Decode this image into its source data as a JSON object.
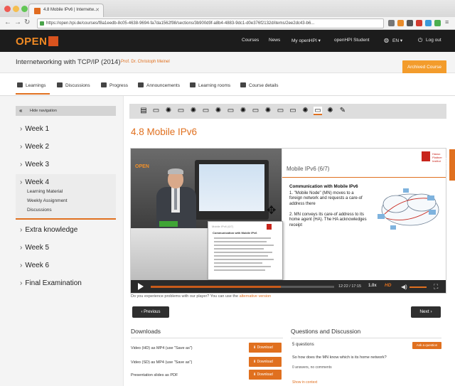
{
  "browser": {
    "tab_title": "4.8 Mobile IPv6 | Internetw...",
    "url": "https://open.hpi.de/courses/f8a1eedb-8c05-4638-9694-fa7da1562f98/sections/3b900d9f-a8b4-4883-9dc1-d0e376f2132d/items/2ee2dc43-b6...",
    "colors": {
      "close": "#ee5a52",
      "minimize": "#f5be4f",
      "zoom": "#62c655"
    }
  },
  "site": {
    "logo": "OPEN",
    "nav": [
      "Courses",
      "News",
      "My openHPI ▾",
      "openHPI Student",
      "EN ▾",
      "Log out"
    ],
    "accent": "#e0701f"
  },
  "course": {
    "title": "Internetworking with TCP/IP (2014)",
    "professor": "Prof. Dr. Christoph Meinel",
    "archived_label": "Archived Course"
  },
  "tabs": [
    "Learnings",
    "Discussions",
    "Progress",
    "Announcements",
    "Learning rooms",
    "Course details"
  ],
  "sidebar": {
    "hide_nav": "Hide navigation",
    "weeks": [
      "Week 1",
      "Week 2",
      "Week 3",
      "Week 4",
      "Extra knowledge",
      "Week 5",
      "Week 6",
      "Final Examination"
    ],
    "week4_items": [
      "Learning Material",
      "Weekly Assignment",
      "Discussions"
    ]
  },
  "item": {
    "title": "4.8 Mobile IPv6",
    "strip_icons": [
      "document-icon",
      "video-icon",
      "bulb-icon",
      "video-icon",
      "bulb-icon",
      "video-icon",
      "bulb-icon",
      "video-icon",
      "bulb-icon",
      "video-icon",
      "bulb-icon",
      "video-icon",
      "video-icon",
      "bulb-icon",
      "video-icon",
      "bulb-icon",
      "edit-icon"
    ],
    "selected_index": 14
  },
  "video": {
    "studio_logo": "OPEN",
    "slide_title": "Mobile IPv6 (6/7)",
    "slide_heading": "Communication with Mobile IPv6",
    "points": [
      "1.  \"Mobile Node\" (MN) moves to a foreign network and requests a care-of address there",
      "2.  MN conveys its care-of address to its home agent (HA). The HA acknowledges receipt"
    ],
    "hpi_label": "Hasso Plattner Institut",
    "popup_title": "Mobile IPv6 (6/7)",
    "popup_heading": "Communication with Mobile IPv6",
    "time": "12:22 / 17:15",
    "speed": "1.0x",
    "hd": "HD",
    "progress": 0.71
  },
  "problem": {
    "text": "Do you experience problems with our player? You can use the ",
    "link": "alternative version"
  },
  "pager": {
    "prev": "‹ Previous",
    "next": "Next ›"
  },
  "downloads": {
    "heading": "Downloads",
    "rows": [
      {
        "label": "Video (HD) as MP4 (use \"Save as\")",
        "button": "Download"
      },
      {
        "label": "Video (SD) as MP4 (use \"Save as\")",
        "button": "Download"
      },
      {
        "label": "Presentation slides as PDF",
        "button": "Download"
      }
    ]
  },
  "qa": {
    "heading": "Questions and Discussion",
    "count": "5 questions",
    "ask": "Ask a question",
    "question": "So how does the MN know which is its home network?",
    "meta": "0 answers, no comments",
    "link": "Show in context"
  },
  "feedback": "Feedback"
}
